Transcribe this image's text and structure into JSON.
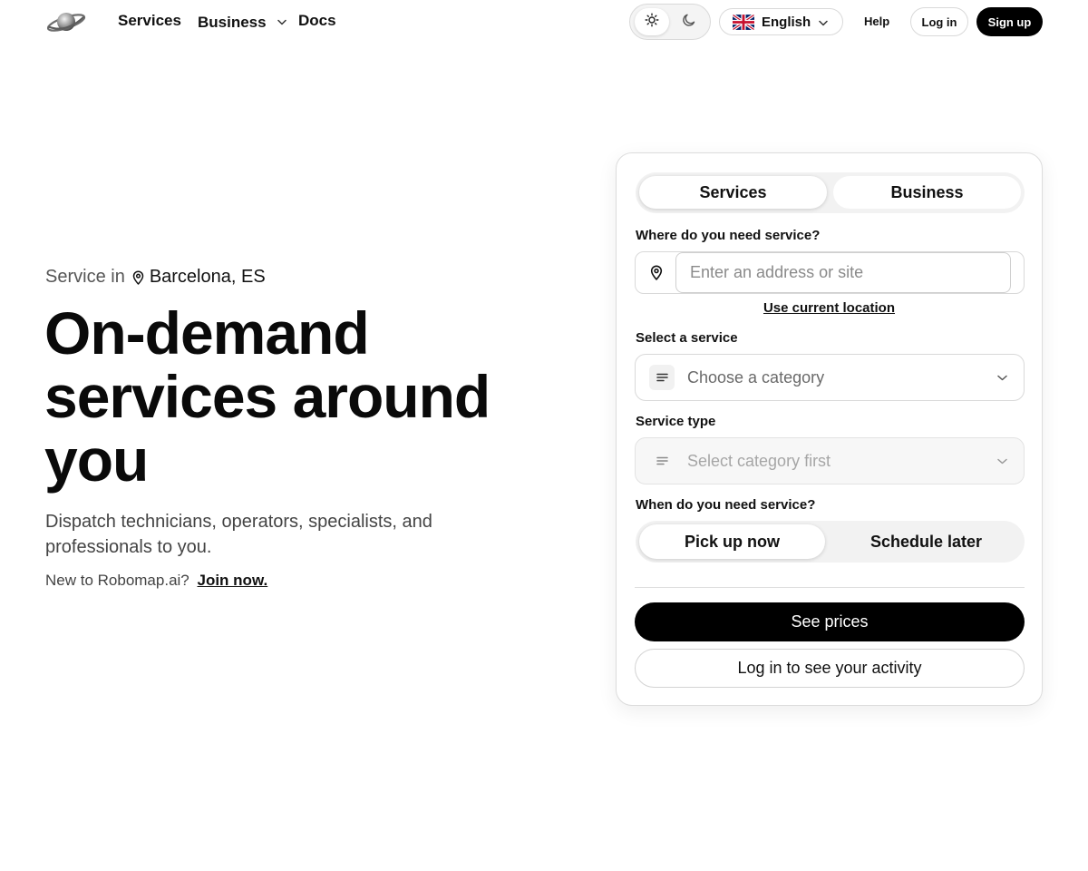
{
  "header": {
    "nav": [
      {
        "label": "Services"
      },
      {
        "label": "Business"
      },
      {
        "label": "Docs"
      }
    ],
    "language": "English",
    "help": "Help",
    "login": "Log in",
    "signup": "Sign up"
  },
  "hero": {
    "service_in_prefix": "Service in",
    "city": "Barcelona, ES",
    "title_line1": "On-demand",
    "title_line2": "services around",
    "title_line3": "you",
    "subtitle": "Dispatch technicians, operators, specialists, and professionals to you.",
    "join_prompt": "New to Robomap.ai?",
    "join_link": "Join now."
  },
  "card": {
    "tabs": [
      {
        "label": "Services",
        "selected": true
      },
      {
        "label": "Business",
        "selected": false
      }
    ],
    "address_label": "Where do you need service?",
    "address_placeholder": "Enter an address or site",
    "address_value": "",
    "use_location": "Use current location",
    "service_label": "Select a service",
    "service_placeholder": "Choose a category",
    "type_label": "Service type",
    "type_placeholder": "Select category first",
    "when_label": "When do you need service?",
    "when_options": [
      {
        "label": "Pick up now",
        "selected": true
      },
      {
        "label": "Schedule later",
        "selected": false
      }
    ],
    "see_prices": "See prices",
    "activity": "Log in to see your activity"
  },
  "icons": {
    "logo": "planet-logo-icon",
    "theme_light": "sun-icon",
    "theme_dark": "moon-icon",
    "flag": "uk-flag-icon",
    "pin": "map-pin-icon",
    "lines": "lines-icon",
    "chevron": "chevron-down-icon"
  },
  "colors": {
    "primary": "#000000",
    "text": "#111111",
    "muted": "#555555",
    "border": "#d9d9d9"
  }
}
